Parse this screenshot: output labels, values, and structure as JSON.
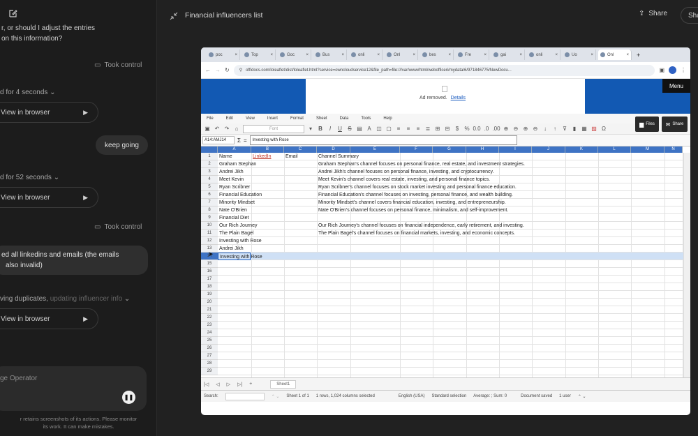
{
  "header": {
    "title": "Financial influencers list",
    "share_label": "Share",
    "share_partial": "Sha"
  },
  "chat": {
    "msg_top_1": "r, or should I adjust the entries",
    "msg_top_2": "on this information?",
    "took_control_1": "Took control",
    "duration_1": "d for 4 seconds",
    "view_browser_1": "View in browser",
    "user_msg_1": "keep going",
    "duration_2": "d for 52 seconds",
    "view_browser_2": "View in browser",
    "took_control_2": "Took control",
    "user_msg_2_line1": "ed all linkedins and emails (the emails",
    "user_msg_2_line2": "also invalid)",
    "status_prefix": "ving duplicates,",
    "status_fade": "updating influencer info",
    "view_browser_3": "View in browser",
    "input_placeholder": "ge Operator",
    "footer_line1": "r retains screenshots of its actions. Please monitor",
    "footer_line2": "its work. It can make mistakes."
  },
  "browser": {
    "tabs": [
      "poc",
      "Top",
      "Goc",
      "Bus",
      "onli",
      "Onl",
      "bes",
      "Fre",
      "gai",
      "onli",
      "Uo",
      "Onl"
    ],
    "url": "offidocs.com/loleaflet/dist/loleaflet.html?service=owncloudservice12&file_path=file:///var/www/html/webofficeri/mydata/6/971846775/NewDocu...",
    "ad_text": "Ad removed.",
    "ad_link": "Details",
    "menu_label": "Menu",
    "files_label": "Files",
    "share_label": "Share",
    "menus": [
      "File",
      "Edit",
      "View",
      "Insert",
      "Format",
      "Sheet",
      "Data",
      "Tools",
      "Help"
    ],
    "font_placeholder": "Font",
    "cell_ref": "A14:AMJ14",
    "formula_value": "Investing with Rose",
    "columns": [
      "A",
      "B",
      "C",
      "D",
      "E",
      "F",
      "G",
      "H",
      "I",
      "J",
      "K",
      "L",
      "M",
      "N"
    ],
    "rows": [
      {
        "n": "1",
        "a": "Name",
        "b": "LinkedIn",
        "c": "Email",
        "d": "Channel Summary"
      },
      {
        "n": "2",
        "a": "Graham Stephan",
        "b": "",
        "c": "",
        "d": "Graham Stephan's channel focuses on personal finance, real estate, and investment strategies."
      },
      {
        "n": "3",
        "a": "Andrei Jikh",
        "b": "",
        "c": "",
        "d": "Andrei Jikh's channel focuses on personal finance, investing, and cryptocurrency."
      },
      {
        "n": "4",
        "a": "Meet Kevin",
        "b": "",
        "c": "",
        "d": "Meet Kevin's channel covers real estate, investing, and personal finance topics."
      },
      {
        "n": "5",
        "a": "Ryan Scribner",
        "b": "",
        "c": "",
        "d": "Ryan Scribner's channel focuses on stock market investing and personal finance education."
      },
      {
        "n": "6",
        "a": "Financial Education",
        "b": "",
        "c": "",
        "d": "Financial Education's channel focuses on investing, personal finance, and wealth building."
      },
      {
        "n": "7",
        "a": "Minority Mindset",
        "b": "",
        "c": "",
        "d": "Minority Mindset's channel covers financial education, investing, and entrepreneurship."
      },
      {
        "n": "8",
        "a": "Nate O'Brien",
        "b": "",
        "c": "",
        "d": "Nate O'Brien's channel focuses on personal finance, minimalism, and self-improvement."
      },
      {
        "n": "9",
        "a": "Financial Diet",
        "b": "",
        "c": "",
        "d": ""
      },
      {
        "n": "10",
        "a": "Our Rich Journey",
        "b": "",
        "c": "",
        "d": "Our Rich Journey's channel focuses on financial independence, early retirement, and investing."
      },
      {
        "n": "11",
        "a": "The Plain Bagel",
        "b": "",
        "c": "",
        "d": "The Plain Bagel's channel focuses on financial markets, investing, and economic concepts."
      },
      {
        "n": "12",
        "a": "Investing with Rose",
        "b": "",
        "c": "",
        "d": ""
      },
      {
        "n": "13",
        "a": "Andrei Jikh",
        "b": "",
        "c": "",
        "d": ""
      },
      {
        "n": "14",
        "a": "Investing with Rose",
        "b": "",
        "c": "",
        "d": ""
      },
      {
        "n": "15",
        "a": "",
        "b": "",
        "c": "",
        "d": ""
      },
      {
        "n": "16",
        "a": "",
        "b": "",
        "c": "",
        "d": ""
      },
      {
        "n": "17",
        "a": "",
        "b": "",
        "c": "",
        "d": ""
      },
      {
        "n": "18",
        "a": "",
        "b": "",
        "c": "",
        "d": ""
      },
      {
        "n": "19",
        "a": "",
        "b": "",
        "c": "",
        "d": ""
      },
      {
        "n": "20",
        "a": "",
        "b": "",
        "c": "",
        "d": ""
      },
      {
        "n": "21",
        "a": "",
        "b": "",
        "c": "",
        "d": ""
      },
      {
        "n": "22",
        "a": "",
        "b": "",
        "c": "",
        "d": ""
      },
      {
        "n": "23",
        "a": "",
        "b": "",
        "c": "",
        "d": ""
      },
      {
        "n": "24",
        "a": "",
        "b": "",
        "c": "",
        "d": ""
      },
      {
        "n": "25",
        "a": "",
        "b": "",
        "c": "",
        "d": ""
      },
      {
        "n": "26",
        "a": "",
        "b": "",
        "c": "",
        "d": ""
      },
      {
        "n": "27",
        "a": "",
        "b": "",
        "c": "",
        "d": ""
      },
      {
        "n": "28",
        "a": "",
        "b": "",
        "c": "",
        "d": ""
      },
      {
        "n": "29",
        "a": "",
        "b": "",
        "c": "",
        "d": ""
      }
    ],
    "sheet_tab": "Sheet1",
    "status": {
      "search_label": "Search:",
      "sheet_of": "Sheet 1 of 1",
      "selection_info": "1 rows, 1,024 columns selected",
      "language": "English (USA)",
      "selection_mode": "Standard selection",
      "average": "Average: ; Sum: 0",
      "doc_saved": "Document saved",
      "users": "1 user"
    }
  },
  "colors": {
    "accent_blue": "#1259b3",
    "header_blue": "#3e73c4",
    "selected_row": "#cfe0f5"
  }
}
